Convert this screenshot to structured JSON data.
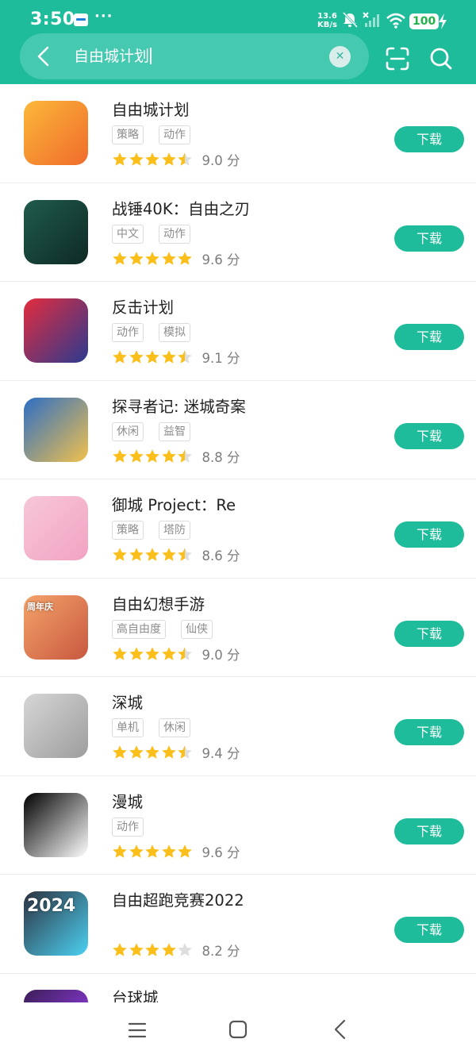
{
  "status_bar": {
    "time": "3:50",
    "dots": "···",
    "speed_value": "13.6",
    "speed_unit": "KB/s",
    "battery": "100",
    "icons": [
      "notification-app-icon",
      "mute-icon",
      "signal-icon",
      "wifi-icon",
      "charging-icon"
    ]
  },
  "search": {
    "query": "自由城计划",
    "icons": [
      "back-arrow-icon",
      "clear-icon",
      "scan-icon",
      "search-icon"
    ]
  },
  "apps": [
    {
      "name": "自由城计划",
      "tags": [
        "策略",
        "动作"
      ],
      "score": "9.0 分",
      "rating": 4.5,
      "download": "下载",
      "icon": "skyscraper-icon",
      "icon_colors": [
        "#fbb83a",
        "#f06b2b"
      ]
    },
    {
      "name": "战锤40K：自由之刃",
      "tags": [
        "中文",
        "动作"
      ],
      "score": "9.6 分",
      "rating": 5,
      "download": "下载",
      "icon": "armored-warrior-icon",
      "icon_colors": [
        "#1f5b4b",
        "#0e2a24"
      ]
    },
    {
      "name": "反击计划",
      "tags": [
        "动作",
        "模拟"
      ],
      "score": "9.1 分",
      "rating": 4.5,
      "download": "下载",
      "icon": "soldier-helmet-icon",
      "icon_colors": [
        "#e32c3e",
        "#2b3a8f"
      ]
    },
    {
      "name": "探寻者记: 迷城奇案",
      "tags": [
        "休闲",
        "益智"
      ],
      "score": "8.8 分",
      "rating": 4.5,
      "download": "下载",
      "icon": "detective-woman-icon",
      "icon_colors": [
        "#2d6ec4",
        "#f1c14d"
      ]
    },
    {
      "name": "御城 Project：Re",
      "tags": [
        "策略",
        "塔防"
      ],
      "score": "8.6 分",
      "rating": 4.5,
      "download": "下载",
      "icon": "anime-girl-icon",
      "icon_colors": [
        "#f7c7d9",
        "#f2a3c1"
      ]
    },
    {
      "name": "自由幻想手游",
      "tags": [
        "高自由度",
        "仙侠"
      ],
      "score": "9.0 分",
      "rating": 4.5,
      "download": "下载",
      "icon": "fantasy-girl-icon",
      "icon_badge": "周年庆",
      "icon_colors": [
        "#f4a36a",
        "#c8583f"
      ]
    },
    {
      "name": "深城",
      "tags": [
        "单机",
        "休闲"
      ],
      "score": "9.4 分",
      "rating": 4.5,
      "download": "下载",
      "icon": "spider-creature-icon",
      "icon_colors": [
        "#d6d6d6",
        "#9d9d9d"
      ]
    },
    {
      "name": "漫城",
      "tags": [
        "动作"
      ],
      "score": "9.6 分",
      "rating": 5,
      "download": "下载",
      "icon": "pixel-runner-icon",
      "icon_colors": [
        "#000000",
        "#ffffff"
      ]
    },
    {
      "name": "自由超跑竞赛2022",
      "tags": [],
      "score": "8.2 分",
      "rating": 4,
      "download": "下载",
      "icon": "race-car-icon",
      "icon_badge": "2024",
      "icon_colors": [
        "#2d3240",
        "#4bd1f2"
      ]
    }
  ],
  "partial_app": {
    "name": "台球城",
    "icon": "billiards-icon",
    "icon_colors": [
      "#3b1d57",
      "#8a3bd6"
    ]
  },
  "theme": {
    "accent": "#1ebc9b",
    "star": "#fbbf1c",
    "star_empty": "#dedede"
  },
  "nav": {
    "icons": [
      "menu-icon",
      "home-icon",
      "back-icon"
    ]
  }
}
